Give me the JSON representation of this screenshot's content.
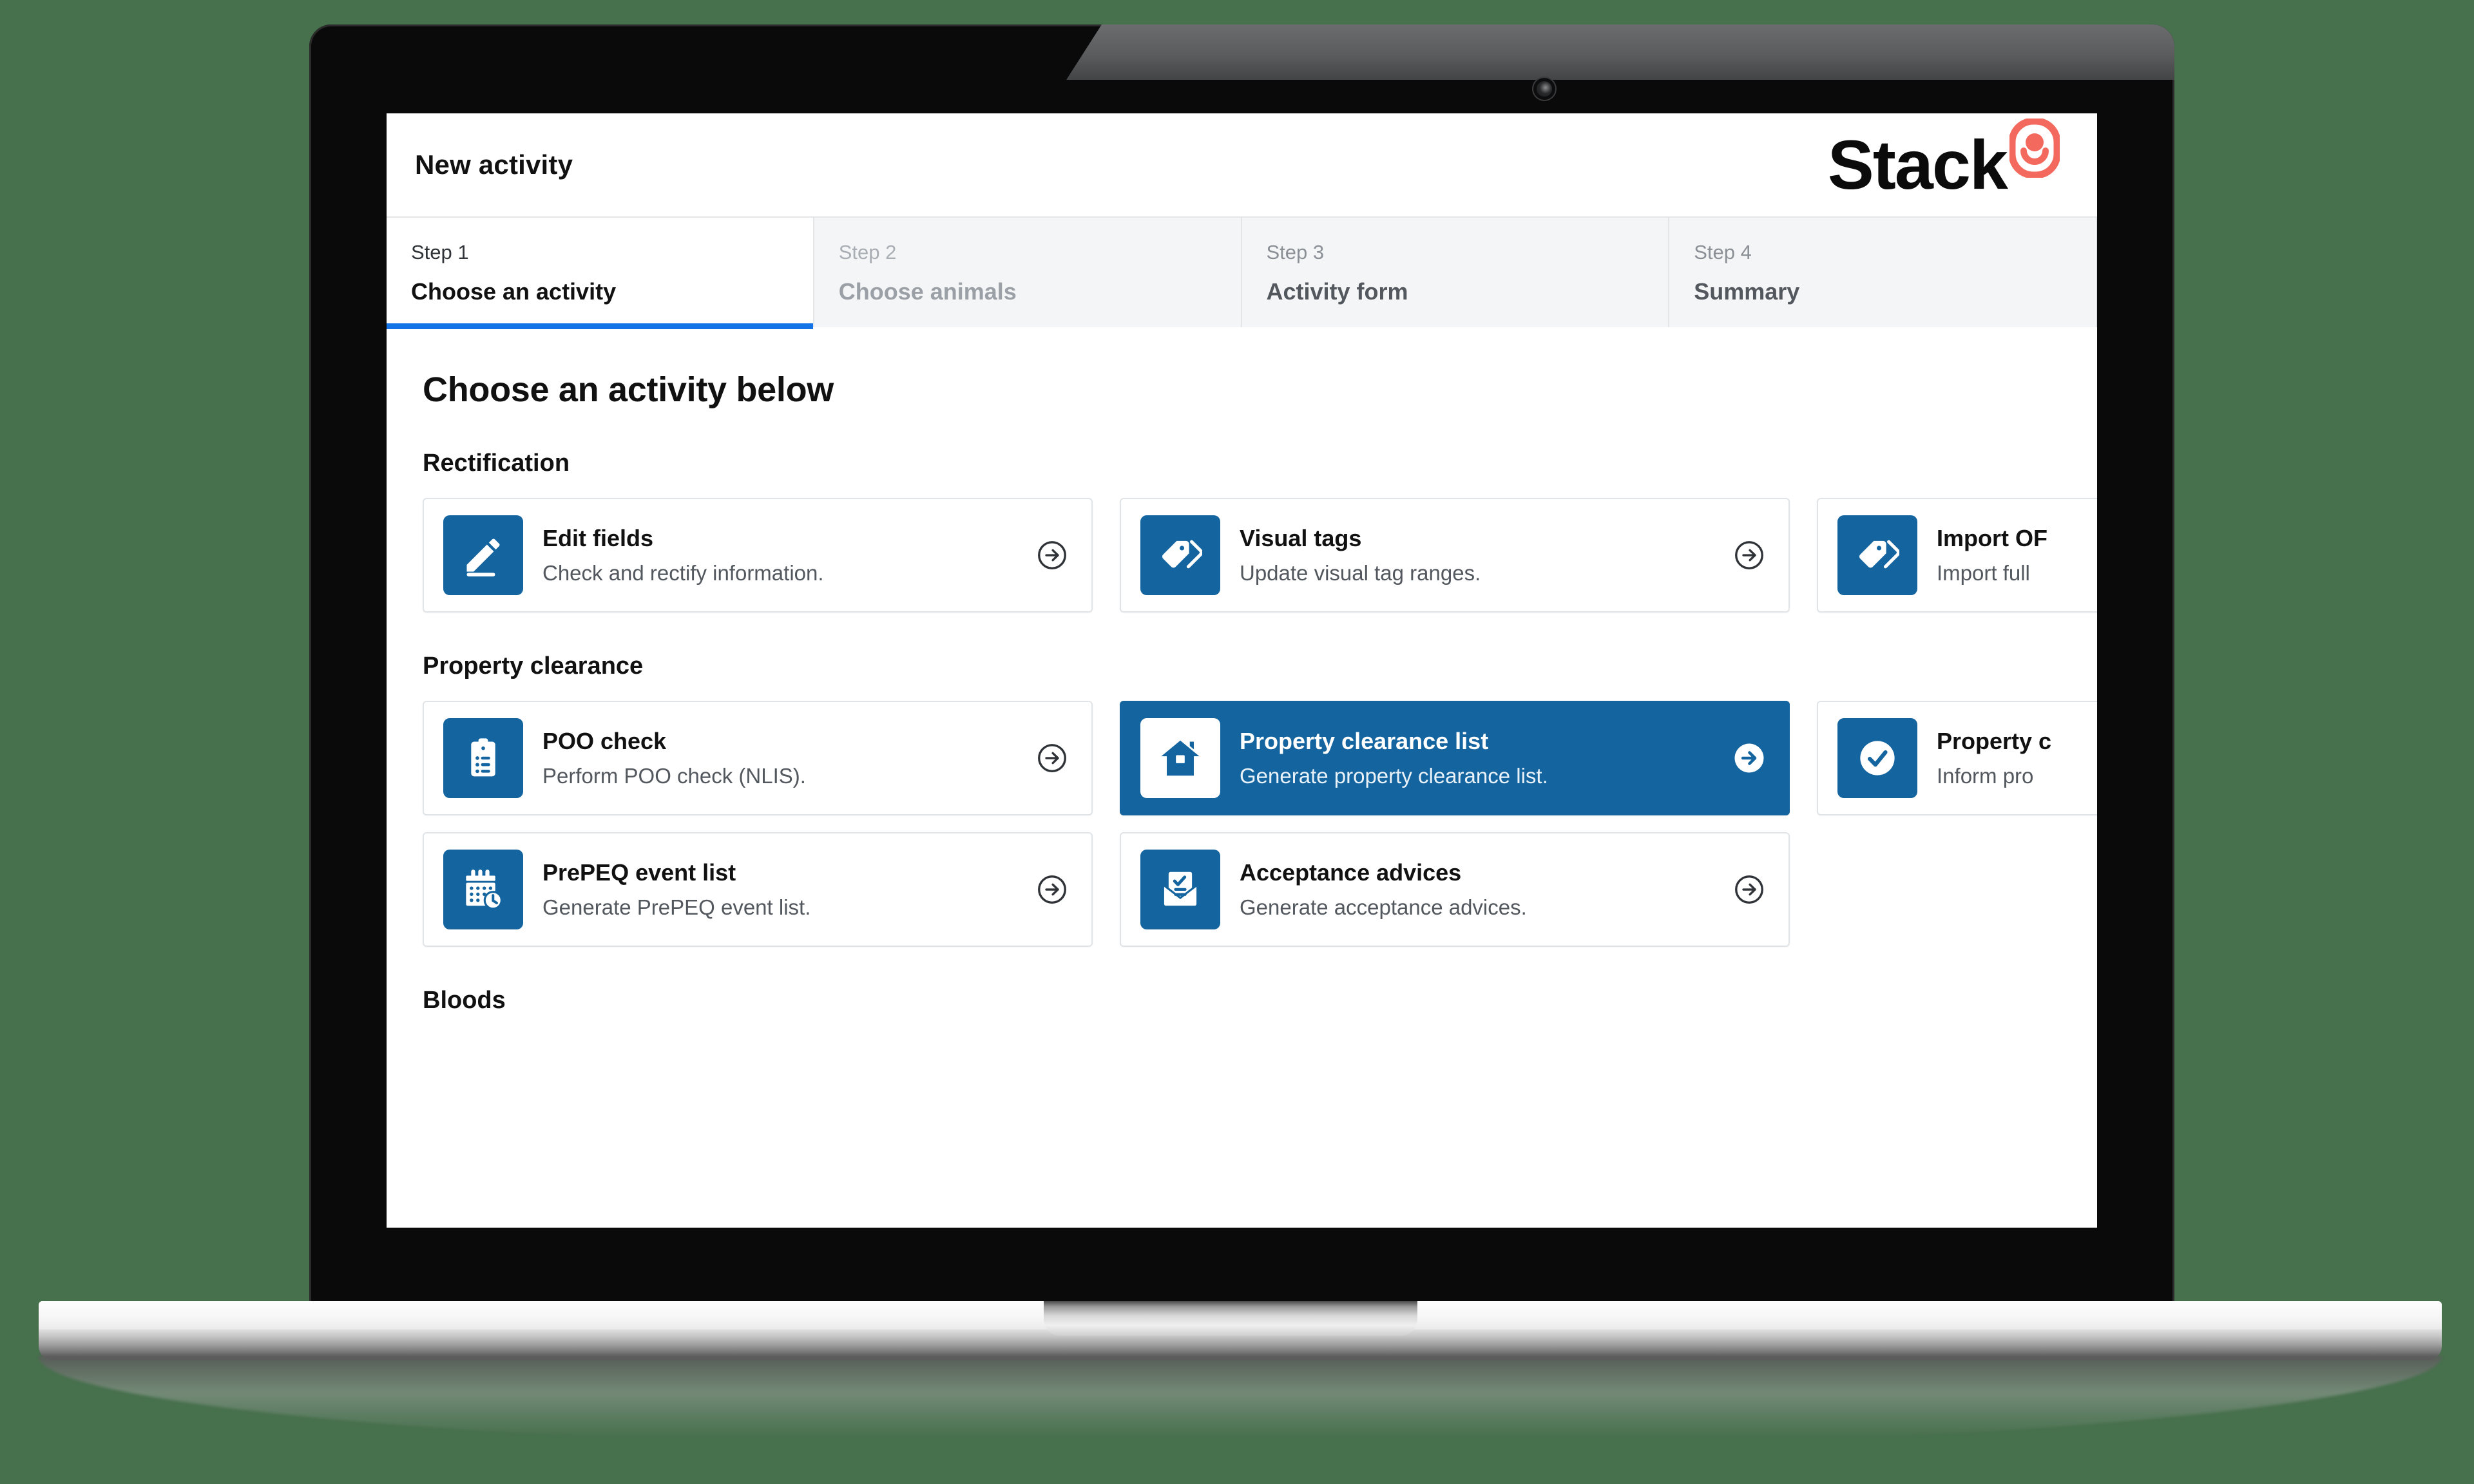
{
  "background_color": "#47704d",
  "accent_color": "#14649f",
  "tab_underline_color": "#1473e6",
  "brand": {
    "wordmark": "Stack",
    "mark_icon": "stack-g-logomark",
    "mark_color": "#f4695d"
  },
  "header": {
    "title": "New activity"
  },
  "stepper": {
    "steps": [
      {
        "number": "Step 1",
        "label": "Choose an activity",
        "state": "active"
      },
      {
        "number": "Step 2",
        "label": "Choose animals",
        "state": "upcoming"
      },
      {
        "number": "Step 3",
        "label": "Activity form",
        "state": "inactive"
      },
      {
        "number": "Step 4",
        "label": "Summary",
        "state": "inactive"
      }
    ]
  },
  "content": {
    "heading": "Choose an activity below",
    "sections": [
      {
        "title": "Rectification",
        "rows": [
          [
            {
              "icon": "pencil-icon",
              "title": "Edit fields",
              "desc": "Check and rectify information.",
              "selected": false
            },
            {
              "icon": "tags-icon",
              "title": "Visual tags",
              "desc": "Update visual tag ranges.",
              "selected": false
            },
            {
              "icon": "tags-icon",
              "title": "Import OF",
              "desc": "Import full",
              "selected": false
            }
          ]
        ]
      },
      {
        "title": "Property clearance",
        "rows": [
          [
            {
              "icon": "clipboard-list-icon",
              "title": "POO check",
              "desc": "Perform POO check (NLIS).",
              "selected": false
            },
            {
              "icon": "house-icon",
              "title": "Property clearance list",
              "desc": "Generate property clearance list.",
              "selected": true
            },
            {
              "icon": "check-circle-icon",
              "title": "Property c",
              "desc": "Inform pro",
              "selected": false
            }
          ],
          [
            {
              "icon": "calendar-clock-icon",
              "title": "PrePEQ event list",
              "desc": "Generate PrePEQ event list.",
              "selected": false
            },
            {
              "icon": "document-check-icon",
              "title": "Acceptance advices",
              "desc": "Generate acceptance advices.",
              "selected": false
            }
          ]
        ]
      },
      {
        "title": "Bloods",
        "rows": []
      }
    ]
  }
}
